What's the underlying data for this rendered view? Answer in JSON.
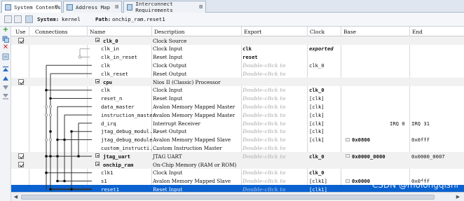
{
  "tabs": [
    {
      "label": "System Contents",
      "close": "⊠"
    },
    {
      "label": "Address Map",
      "close": "⊠"
    },
    {
      "label": "Interconnect Requirements",
      "close": "⊠"
    }
  ],
  "pathbar": {
    "system_label": "System:",
    "system_value": "kernel",
    "path_label": "Path:",
    "path_value": "onchip_ram.reset1"
  },
  "headers": {
    "use": "Use",
    "connections": "Connections",
    "name": "Name",
    "description": "Description",
    "export": "Export",
    "clock": "Clock",
    "base": "Base",
    "end": "End"
  },
  "rows": [
    {
      "kind": "sys",
      "use": true,
      "name": "clk_0",
      "desc": "Clock Source",
      "export": "",
      "exportGhost": false,
      "clock": "",
      "clockStyle": "",
      "base": "",
      "baseBold": false,
      "lock": false,
      "end": "",
      "irq": ""
    },
    {
      "kind": "if",
      "name": "clk_in",
      "desc": "Clock Input",
      "export": "clk",
      "exportGhost": false,
      "clock": "exported",
      "clockStyle": "it",
      "base": "",
      "end": "",
      "irq": ""
    },
    {
      "kind": "if",
      "name": "clk_in_reset",
      "desc": "Reset Input",
      "export": "reset",
      "exportGhost": false,
      "clock": "",
      "clockStyle": "",
      "base": "",
      "end": "",
      "irq": ""
    },
    {
      "kind": "if",
      "name": "clk",
      "desc": "Clock Output",
      "export": "Double-click to",
      "exportGhost": true,
      "clock": "clk_0",
      "clockStyle": "",
      "base": "",
      "end": "",
      "irq": ""
    },
    {
      "kind": "if",
      "name": "clk_reset",
      "desc": "Reset Output",
      "export": "Double-click to",
      "exportGhost": true,
      "clock": "",
      "clockStyle": "",
      "base": "",
      "end": "",
      "irq": ""
    },
    {
      "kind": "sys",
      "use": true,
      "name": "cpu",
      "desc": "Nios II (Classic) Processor",
      "export": "",
      "exportGhost": false,
      "clock": "",
      "clockStyle": "",
      "base": "",
      "end": "",
      "irq": ""
    },
    {
      "kind": "if",
      "name": "clk",
      "desc": "Clock Input",
      "export": "Double-click to",
      "exportGhost": true,
      "clock": "clk_0",
      "clockStyle": "b",
      "base": "",
      "end": "",
      "irq": ""
    },
    {
      "kind": "if",
      "name": "reset_n",
      "desc": "Reset Input",
      "export": "Double-click to",
      "exportGhost": true,
      "clock": "[clk]",
      "clockStyle": "",
      "base": "",
      "end": "",
      "irq": ""
    },
    {
      "kind": "if",
      "name": "data_master",
      "desc": "Avalon Memory Mapped Master",
      "export": "Double-click to",
      "exportGhost": true,
      "clock": "[clk]",
      "clockStyle": "",
      "base": "",
      "end": "",
      "irq": ""
    },
    {
      "kind": "if",
      "name": "instruction_master",
      "desc": "Avalon Memory Mapped Master",
      "export": "Double-click to",
      "exportGhost": true,
      "clock": "[clk]",
      "clockStyle": "",
      "base": "",
      "end": "",
      "irq": ""
    },
    {
      "kind": "if",
      "name": "d_irq",
      "desc": "Interrupt Receiver",
      "export": "Double-click to",
      "exportGhost": true,
      "clock": "[clk]",
      "clockStyle": "",
      "base": "",
      "end": "IRQ 31",
      "irq": "IRQ 0"
    },
    {
      "kind": "if",
      "name": "jtag_debug_modul...",
      "desc": "Reset Output",
      "export": "Double-click to",
      "exportGhost": true,
      "clock": "[clk]",
      "clockStyle": "",
      "base": "",
      "end": "",
      "irq": ""
    },
    {
      "kind": "if",
      "name": "jtag_debug_module",
      "desc": "Avalon Memory Mapped Slave",
      "export": "Double-click to",
      "exportGhost": true,
      "clock": "[clk]",
      "clockStyle": "",
      "base": "0x0800",
      "baseBold": true,
      "lock": true,
      "end": "0x0fff",
      "irq": ""
    },
    {
      "kind": "if",
      "name": "custom_instructi...",
      "desc": "Custom Instruction Master",
      "export": "Double-click to",
      "exportGhost": true,
      "clock": "",
      "clockStyle": "",
      "base": "",
      "end": "",
      "irq": ""
    },
    {
      "kind": "sys",
      "use": true,
      "name": "jtag_uart",
      "desc": "JTAG UART",
      "export": "Double-click to",
      "exportGhost": true,
      "clock": "clk_0",
      "clockStyle": "b",
      "base": "0x0000_0000",
      "baseBold": true,
      "lock": true,
      "end": "0x0000_0007",
      "irq": ""
    },
    {
      "kind": "sys",
      "use": true,
      "name": "onchip_ram",
      "desc": "On-Chip Memory (RAM or ROM)",
      "export": "",
      "exportGhost": false,
      "clock": "",
      "clockStyle": "",
      "base": "",
      "end": "",
      "irq": ""
    },
    {
      "kind": "if",
      "name": "clk1",
      "desc": "Clock Input",
      "export": "Double-click to",
      "exportGhost": true,
      "clock": "clk_0",
      "clockStyle": "b",
      "base": "",
      "end": "",
      "irq": ""
    },
    {
      "kind": "if",
      "name": "s1",
      "desc": "Avalon Memory Mapped Slave",
      "export": "Double-click to",
      "exportGhost": true,
      "clock": "[clk1]",
      "clockStyle": "",
      "base": "0x0000",
      "baseBold": true,
      "lock": true,
      "end": "0x0fff",
      "irq": ""
    },
    {
      "kind": "sel",
      "name": "reset1",
      "desc": "Reset Input",
      "export": "Double-click to",
      "exportGhost": true,
      "clock": "[clk1]",
      "clockStyle": "",
      "base": "",
      "end": "",
      "irq": ""
    }
  ],
  "watermark": "CSDN @molongqishi"
}
